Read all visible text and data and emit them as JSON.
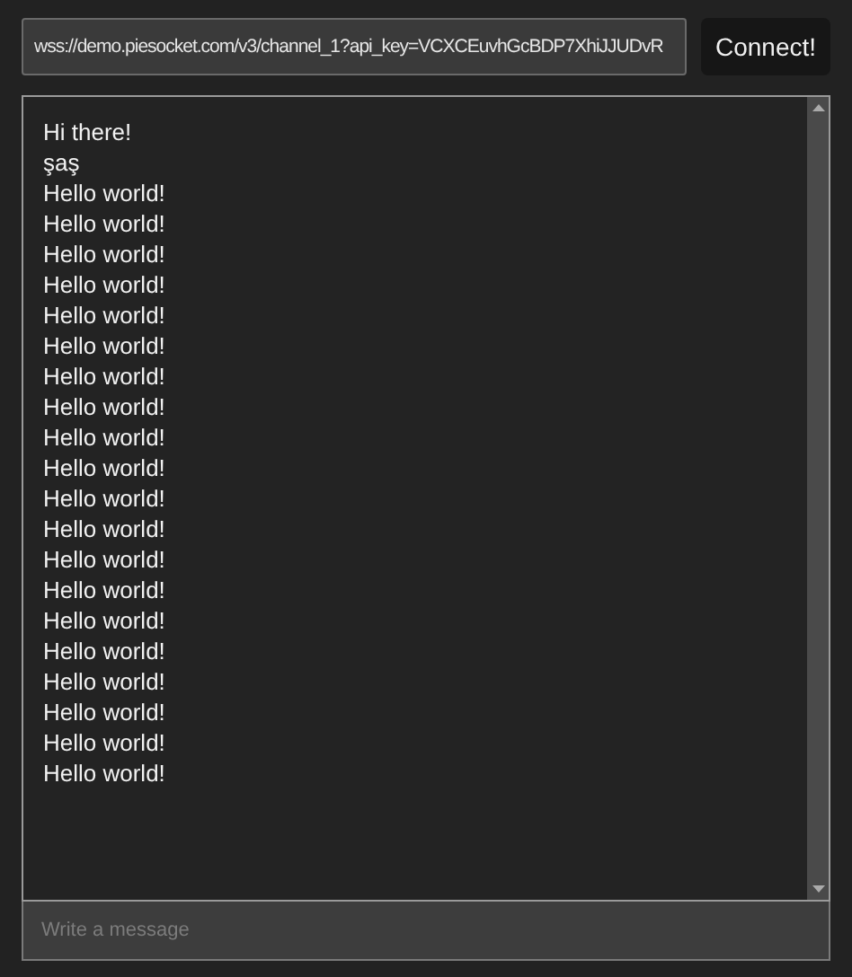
{
  "url_field": {
    "value": "wss://demo.piesocket.com/v3/channel_1?api_key=VCXCEuvhGcBDP7XhiJJUDvR"
  },
  "connect_button": {
    "label": "Connect!"
  },
  "messages": [
    "Hi there!",
    "şaş",
    "Hello world!",
    "Hello world!",
    "Hello world!",
    "Hello world!",
    "Hello world!",
    "Hello world!",
    "Hello world!",
    "Hello world!",
    "Hello world!",
    "Hello world!",
    "Hello world!",
    "Hello world!",
    "Hello world!",
    "Hello world!",
    "Hello world!",
    "Hello world!",
    "Hello world!",
    "Hello world!",
    "Hello world!",
    "Hello world!"
  ],
  "message_field": {
    "placeholder": "Write a message"
  }
}
